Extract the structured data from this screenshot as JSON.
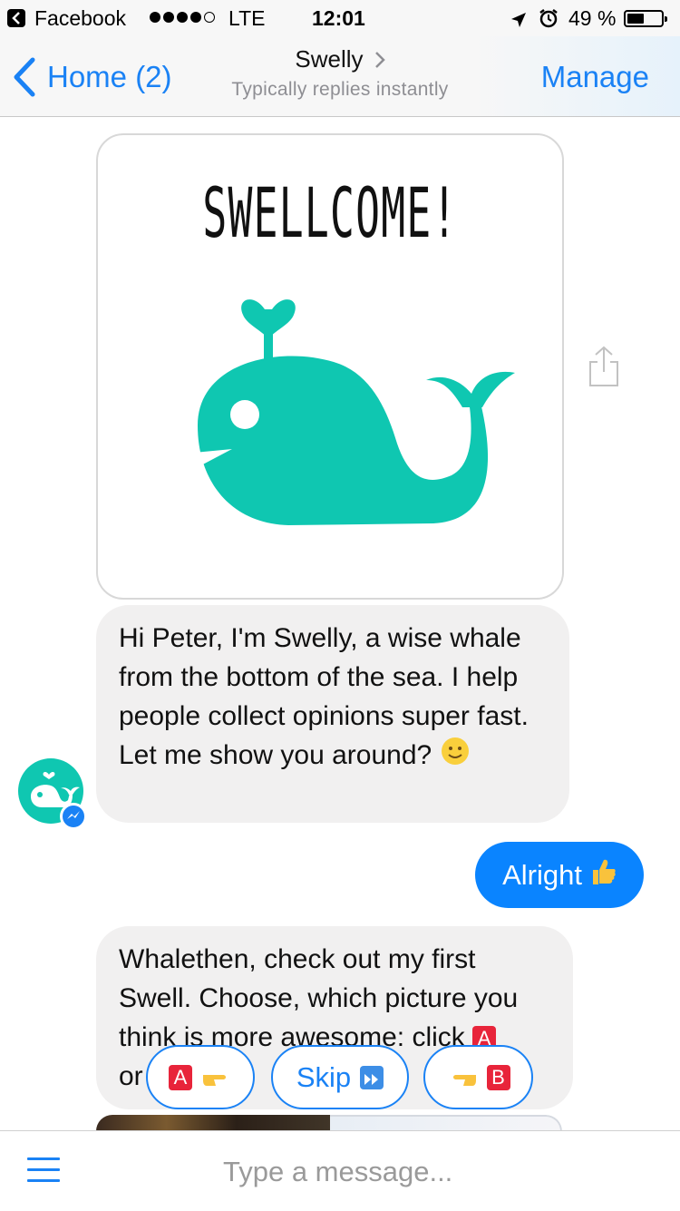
{
  "status_bar": {
    "app": "Facebook",
    "network": "LTE",
    "time": "12:01",
    "battery": "49 %"
  },
  "nav": {
    "back_label": "Home (2)",
    "title": "Swelly",
    "subtitle": "Typically replies instantly",
    "manage_label": "Manage"
  },
  "image_card": {
    "heading": "SWELLCOME!"
  },
  "messages": {
    "bot_1": "Hi Peter, I'm Swelly, a wise whale from the bottom of the sea. I help people collect opinions super fast. Let me show you around?",
    "user_1": "Alright",
    "bot_2_line_a": "Whalethen, check out my first Swell. Choose, which picture you think is more awesome: click",
    "bot_2_or": "or"
  },
  "quick_replies": {
    "option_a": "A",
    "skip": "Skip",
    "option_b": "B"
  },
  "composer": {
    "placeholder": "Type a message..."
  },
  "colors": {
    "accent": "#1a82f5",
    "whale": "#0fc7b1",
    "user_bubble": "#0a84ff",
    "bot_bubble": "#f1f0f0"
  }
}
